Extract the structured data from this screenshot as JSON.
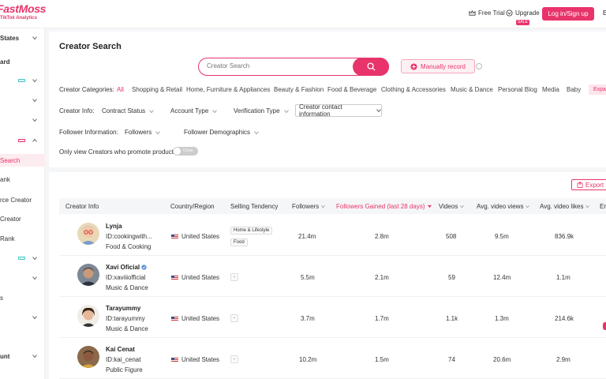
{
  "header": {
    "logo": "FastMoss",
    "logo_sub": "TikTok Analytics",
    "free_trial": "Free Trial",
    "upgrade": "Upgrade",
    "sale_badge": "SALE",
    "login": "Log in/Sign up",
    "lang": "E"
  },
  "sidebar": {
    "region": "States",
    "dashboard": "ard",
    "search": "Search",
    "rank": "ank",
    "source_creator": "rce Creator",
    "creator": "Creator",
    "rank2": "Rank",
    "s": "s",
    "account": "unt"
  },
  "page": {
    "title": "Creator Search",
    "search_placeholder": "Creator Search",
    "manual_record": "Manually record",
    "categories_label": "Creator Categories:",
    "categories": [
      "All",
      "Shopping & Retail",
      "Home, Furniture & Appliances",
      "Beauty & Fashion",
      "Food & Beverage",
      "Clothing & Accessories",
      "Music & Dance",
      "Personal Blog",
      "Media",
      "Baby"
    ],
    "expand": "Expa",
    "info_label": "Creator Info:",
    "contract_status": "Contract Status",
    "account_type": "Account Type",
    "verification_type": "Verification Type",
    "contact_info": "Creator contact information",
    "follower_label": "Follower Information:",
    "followers": "Followers",
    "follower_demo": "Follower Demographics",
    "promote_label": "Only view Creators who promote products:",
    "toggle_text": "Close"
  },
  "table": {
    "export": "Export",
    "headers": {
      "creator_info": "Creator Info",
      "country": "Country/Region",
      "selling": "Selling Tendency",
      "followers": "Followers",
      "gained": "Followers Gained (last 28 days)",
      "videos": "Videos",
      "avg_views": "Avg. video views",
      "avg_likes": "Avg. video likes",
      "extra": "En"
    },
    "rows": [
      {
        "name": "Lynja",
        "id": "ID:cookingwith...",
        "category": "Food & Cooking",
        "country": "United States",
        "tags": [
          "Home & Lifestyle",
          "Food"
        ],
        "followers": "21.4m",
        "gained": "2.8m",
        "videos": "508",
        "views": "9.5m",
        "likes": "836.9k"
      },
      {
        "name": "Xavi Oficial",
        "id": "ID:xaviiiofficial",
        "category": "Music & Dance",
        "country": "United States",
        "tags": [
          "-"
        ],
        "followers": "5.5m",
        "gained": "2.1m",
        "videos": "59",
        "views": "12.4m",
        "likes": "1.1m"
      },
      {
        "name": "Tarayummy",
        "id": "ID:tarayummy",
        "category": "Music & Dance",
        "country": "United States",
        "tags": [
          "-"
        ],
        "followers": "3.7m",
        "gained": "1.7m",
        "videos": "1.1k",
        "views": "1.3m",
        "likes": "214.6k"
      },
      {
        "name": "Kai Cenat",
        "id": "ID:kai_cenat",
        "category": "Public Figure",
        "country": "United States",
        "tags": [
          "-"
        ],
        "followers": "10.2m",
        "gained": "1.5m",
        "videos": "74",
        "views": "20.6m",
        "likes": "2.9m"
      }
    ]
  },
  "colors": {
    "accent": "#e8346a",
    "teal": "#41c7c7"
  }
}
